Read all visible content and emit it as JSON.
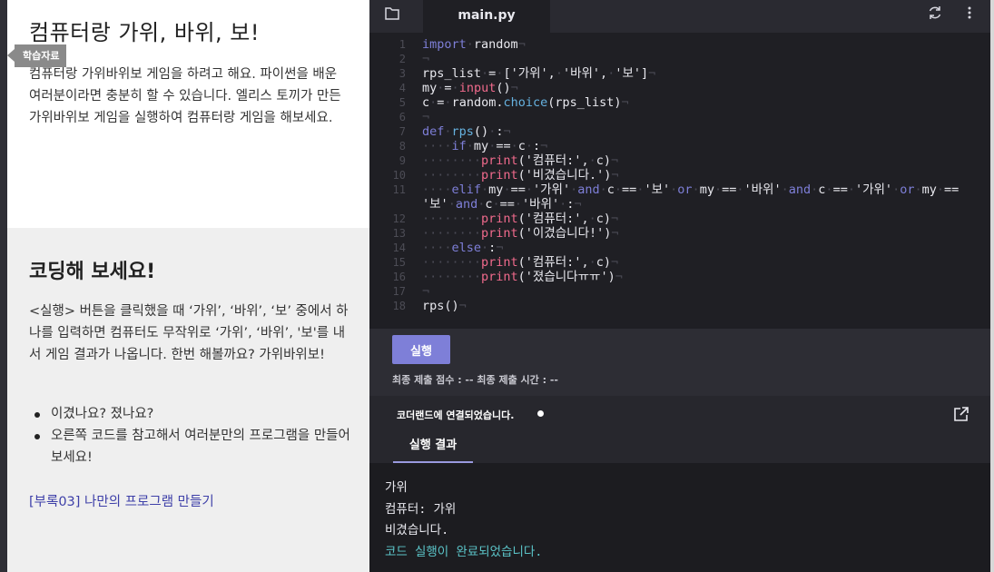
{
  "lesson": {
    "title": "컴퓨터랑 가위, 바위, 보!",
    "badge": "학습자료",
    "description": "컴퓨터랑 가위바위보 게임을 하려고 해요. 파이썬을 배운 여러분이라면 충분히 할 수 있습니다. 엘리스 토끼가 만든 가위바위보 게임을 실행하여 컴퓨터랑 게임을 해보세요."
  },
  "coding": {
    "title": "코딩해 보세요!",
    "description": "<실행> 버튼을 클릭했을 때 ‘가위’, ‘바위’, ‘보’ 중에서 하나를 입력하면 컴퓨터도 무작위로 ‘가위’, ‘바위’, '보'를 내서 게임 결과가 나옵니다. 한번 해볼까요? 가위바위보!",
    "bullets": [
      "이겼나요? 졌나요?",
      "오른쪽 코드를 참고해서 여러분만의 프로그램을 만들어 보세요!"
    ],
    "appendix_link": "[부록03] 나만의 프로그램 만들기"
  },
  "editor": {
    "filename": "main.py",
    "line_numbers": [
      "1",
      "2",
      "3",
      "4",
      "5",
      "6",
      "7",
      "8",
      "9",
      "10",
      "11",
      "12",
      "13",
      "14",
      "15",
      "16",
      "17",
      "18"
    ],
    "run_label": "실행",
    "score_info": "최종 제출 점수 : --  최종 제출 시간 : --",
    "connect_status": "코더랜드에 연결되었습니다.",
    "result_tab": "실행 결과"
  },
  "output": {
    "lines": [
      "가위",
      "컴퓨터: 가위",
      "비겼습니다."
    ],
    "done": "코드 실행이 완료되었습니다."
  },
  "icons": {
    "folder": "folder-icon",
    "refresh": "refresh-icon",
    "more": "more-vertical-icon",
    "open": "external-link-icon"
  },
  "colors": {
    "accent": "#7e7fd8",
    "link": "#3d3fa8",
    "done": "#5bc4c8"
  }
}
